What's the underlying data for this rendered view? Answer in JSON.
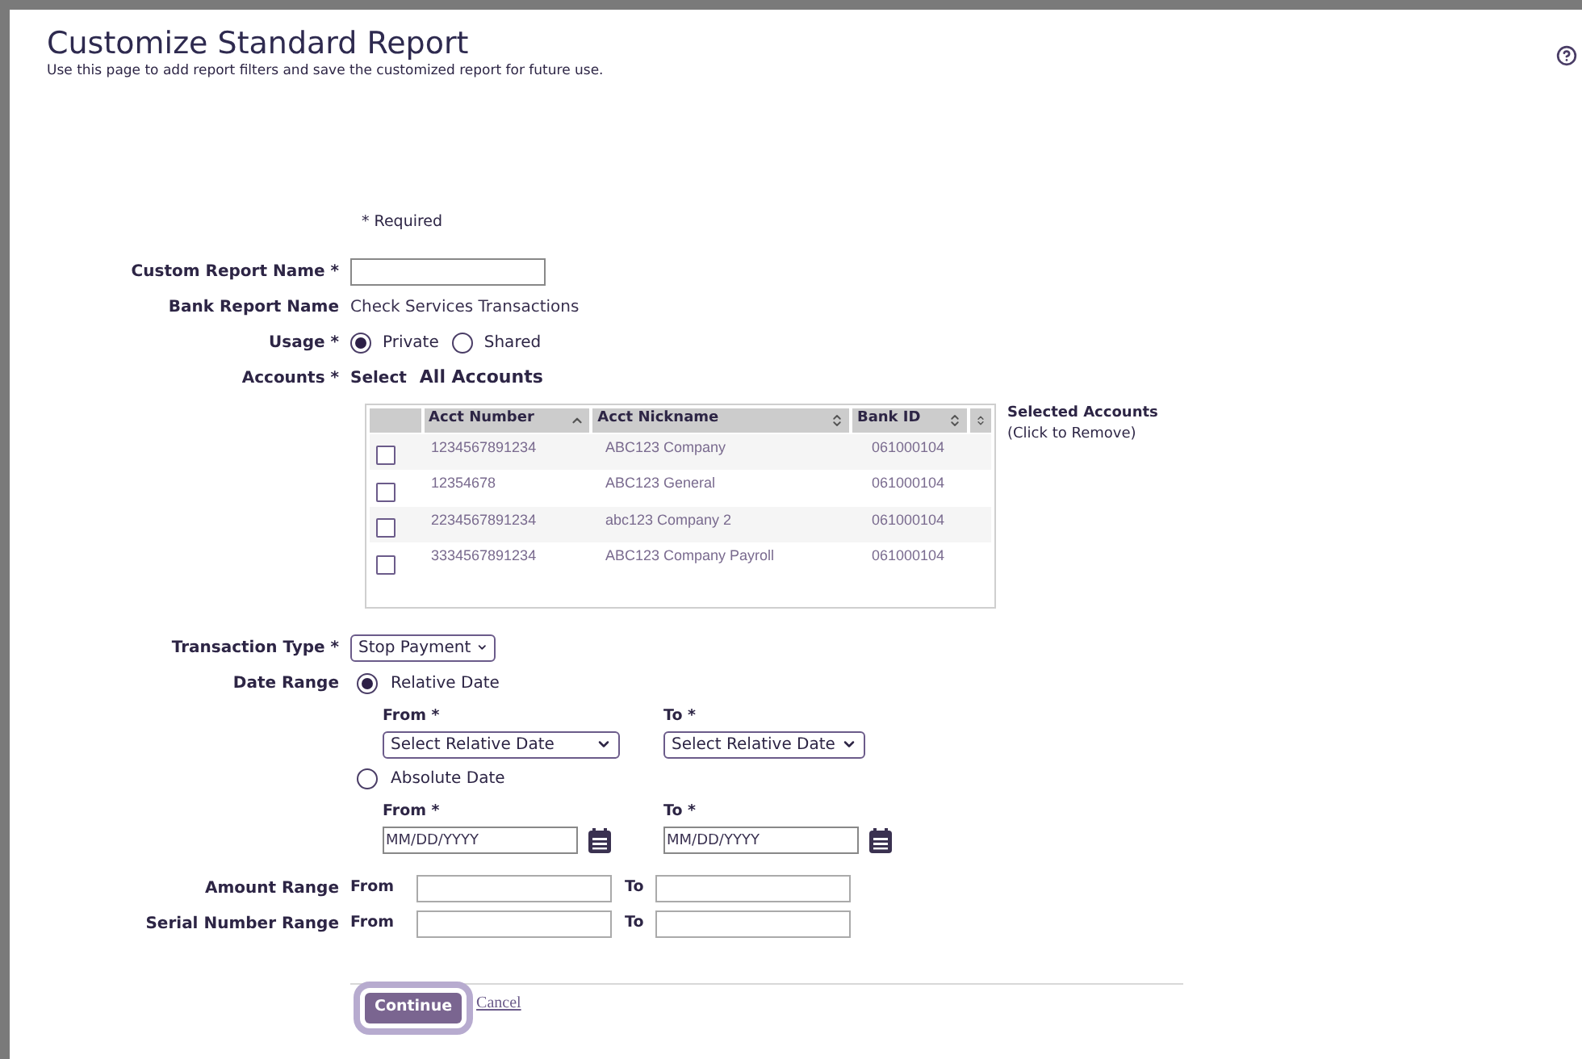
{
  "header": {
    "title": "Customize Standard Report",
    "subtitle": "Use this page to add report filters and save the customized report for future use."
  },
  "required_note": "* Required",
  "custom_report_name": {
    "label": "Custom Report Name *"
  },
  "bank_report_name": {
    "label": "Bank Report Name",
    "value": "Check Services Transactions"
  },
  "usage": {
    "label": "Usage *",
    "options": [
      {
        "label": "Private",
        "selected": true
      },
      {
        "label": "Shared",
        "selected": false
      }
    ]
  },
  "accounts": {
    "label": "Accounts *",
    "select_label": "Select",
    "all_link": "All Accounts",
    "columns": [
      {
        "label": "Acct Number",
        "sorted": true
      },
      {
        "label": "Acct Nickname",
        "sorted": false
      },
      {
        "label": "Bank ID",
        "sorted": false
      },
      {
        "sorted": false
      }
    ],
    "rows": [
      {
        "cells": [
          "1234567891234",
          "ABC123 Company",
          "061000104"
        ],
        "checked": false
      },
      {
        "cells": [
          "12354678",
          "ABC123 General",
          "061000104"
        ],
        "checked": false
      },
      {
        "cells": [
          "2234567891234",
          "abc123 Company 2",
          "061000104"
        ],
        "checked": false
      },
      {
        "cells": [
          "3334567891234",
          "ABC123 Company Payroll",
          "061000104"
        ],
        "checked": false
      }
    ],
    "selected_title": "Selected Accounts",
    "selected_hint": "(Click to Remove)"
  },
  "transaction_type": {
    "label": "Transaction Type *",
    "value": "Stop Payment"
  },
  "date_range": {
    "label": "Date Range",
    "options": [
      {
        "kind": "select",
        "label": "Relative Date",
        "selected": true,
        "from_label": "From *",
        "to_label": "To *",
        "from_value": "Select Relative Date",
        "to_value": "Select Relative Date"
      },
      {
        "kind": "date",
        "label": "Absolute Date",
        "selected": false,
        "from_label": "From *",
        "to_label": "To *",
        "from_placeholder": "MM/DD/YYYY",
        "to_placeholder": "MM/DD/YYYY"
      }
    ]
  },
  "ranges": [
    {
      "label": "Amount Range",
      "from_label": "From",
      "to_label": "To"
    },
    {
      "label": "Serial Number Range",
      "from_label": "From",
      "to_label": "To"
    }
  ],
  "buttons": {
    "continue": "Continue",
    "cancel": "Cancel"
  }
}
